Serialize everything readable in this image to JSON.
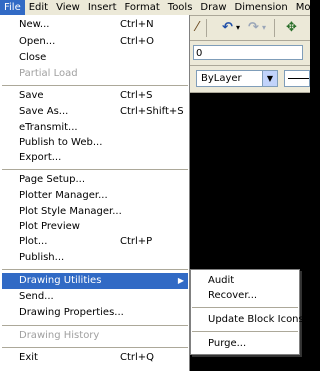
{
  "menubar": {
    "items": [
      "File",
      "Edit",
      "View",
      "Insert",
      "Format",
      "Tools",
      "Draw",
      "Dimension",
      "Modify"
    ]
  },
  "toolbar": {
    "icons": [
      "brush-icon",
      "undo-icon",
      "redo-icon",
      "redo-dropdown-icon",
      "pan-icon"
    ],
    "text_field_value": "0",
    "layer_combo_value": "ByLayer"
  },
  "file_menu": {
    "items": [
      {
        "label": "New...",
        "shortcut": "Ctrl+N"
      },
      {
        "label": "Open...",
        "shortcut": "Ctrl+O"
      },
      {
        "label": "Close",
        "shortcut": ""
      },
      {
        "label": "Partial Load",
        "shortcut": "",
        "disabled": true
      },
      {
        "label": "Save",
        "shortcut": "Ctrl+S"
      },
      {
        "label": "Save As...",
        "shortcut": "Ctrl+Shift+S"
      },
      {
        "label": "eTransmit...",
        "shortcut": ""
      },
      {
        "label": "Publish to Web...",
        "shortcut": ""
      },
      {
        "label": "Export...",
        "shortcut": ""
      },
      {
        "label": "Page Setup...",
        "shortcut": ""
      },
      {
        "label": "Plotter Manager...",
        "shortcut": ""
      },
      {
        "label": "Plot Style Manager...",
        "shortcut": ""
      },
      {
        "label": "Plot Preview",
        "shortcut": ""
      },
      {
        "label": "Plot...",
        "shortcut": "Ctrl+P"
      },
      {
        "label": "Publish...",
        "shortcut": ""
      },
      {
        "label": "Drawing Utilities",
        "shortcut": "",
        "submenu": true,
        "highlighted": true
      },
      {
        "label": "Send...",
        "shortcut": ""
      },
      {
        "label": "Drawing Properties...",
        "shortcut": ""
      },
      {
        "label": "Drawing History",
        "shortcut": "",
        "disabled": true
      },
      {
        "label": "Exit",
        "shortcut": "Ctrl+Q"
      }
    ]
  },
  "submenu": {
    "items": [
      "Audit",
      "Recover...",
      "Update Block Icons",
      "Purge..."
    ]
  },
  "colors": {
    "highlight": "#316ac5",
    "menubar_bg": "#ece9d8",
    "menu_bg": "#ffffff",
    "disabled_text": "#a0a0a0",
    "canvas_bg": "#000000"
  }
}
